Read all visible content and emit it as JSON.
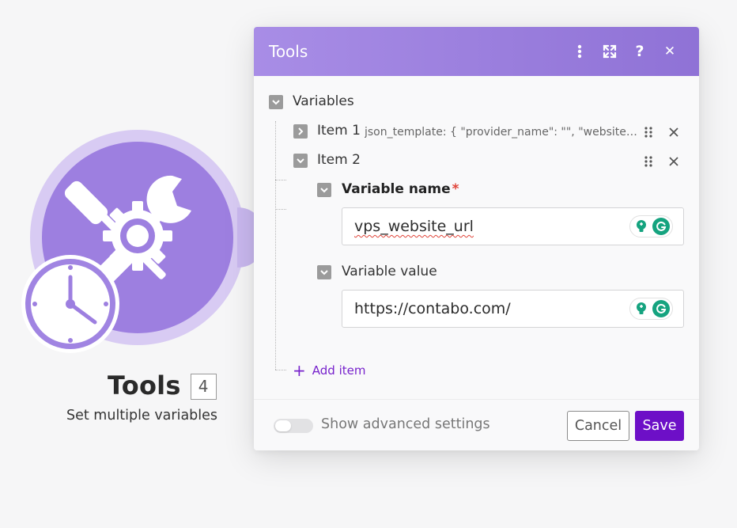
{
  "module": {
    "title": "Tools",
    "badge": "4",
    "subtitle": "Set multiple variables"
  },
  "dialog": {
    "title": "Tools",
    "header_icons": [
      "more-vertical-icon",
      "expand-icon",
      "help-icon",
      "close-icon"
    ],
    "help_glyph": "?",
    "close_glyph": "✕"
  },
  "variables": {
    "label": "Variables",
    "items": [
      {
        "label": "Item 1",
        "preview": "json_template: { \"provider_name\": \"\", \"website_url\": \"\" }",
        "expanded": false
      },
      {
        "label": "Item 2",
        "expanded": true,
        "name_label": "Variable name",
        "required_mark": "*",
        "name_value": "vps_website_url",
        "value_label": "Variable value",
        "value_value": "https://contabo.com/"
      }
    ],
    "add_item_label": "Add item",
    "add_item_glyph": "+"
  },
  "footer": {
    "advanced_label": "Show advanced settings",
    "advanced_enabled": false,
    "cancel_label": "Cancel",
    "save_label": "Save"
  },
  "colors": {
    "header_start": "#a88de6",
    "header_end": "#8f72d6",
    "accent": "#7722cc",
    "save": "#6d0fc7",
    "grammarly": "#15a37f",
    "module_circle": "#9d7fe0"
  }
}
